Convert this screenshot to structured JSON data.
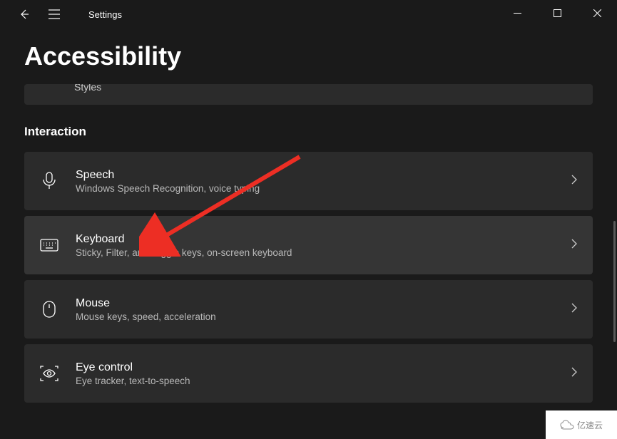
{
  "titlebar": {
    "title": "Settings"
  },
  "page": {
    "title": "Accessibility"
  },
  "partial_card": {
    "subtitle": "Styles"
  },
  "section": {
    "header": "Interaction"
  },
  "cards": {
    "speech": {
      "title": "Speech",
      "subtitle": "Windows Speech Recognition, voice typing"
    },
    "keyboard": {
      "title": "Keyboard",
      "subtitle": "Sticky, Filter, and Toggle keys, on-screen keyboard"
    },
    "mouse": {
      "title": "Mouse",
      "subtitle": "Mouse keys, speed, acceleration"
    },
    "eye_control": {
      "title": "Eye control",
      "subtitle": "Eye tracker, text-to-speech"
    }
  },
  "watermark": {
    "text": "亿速云"
  }
}
